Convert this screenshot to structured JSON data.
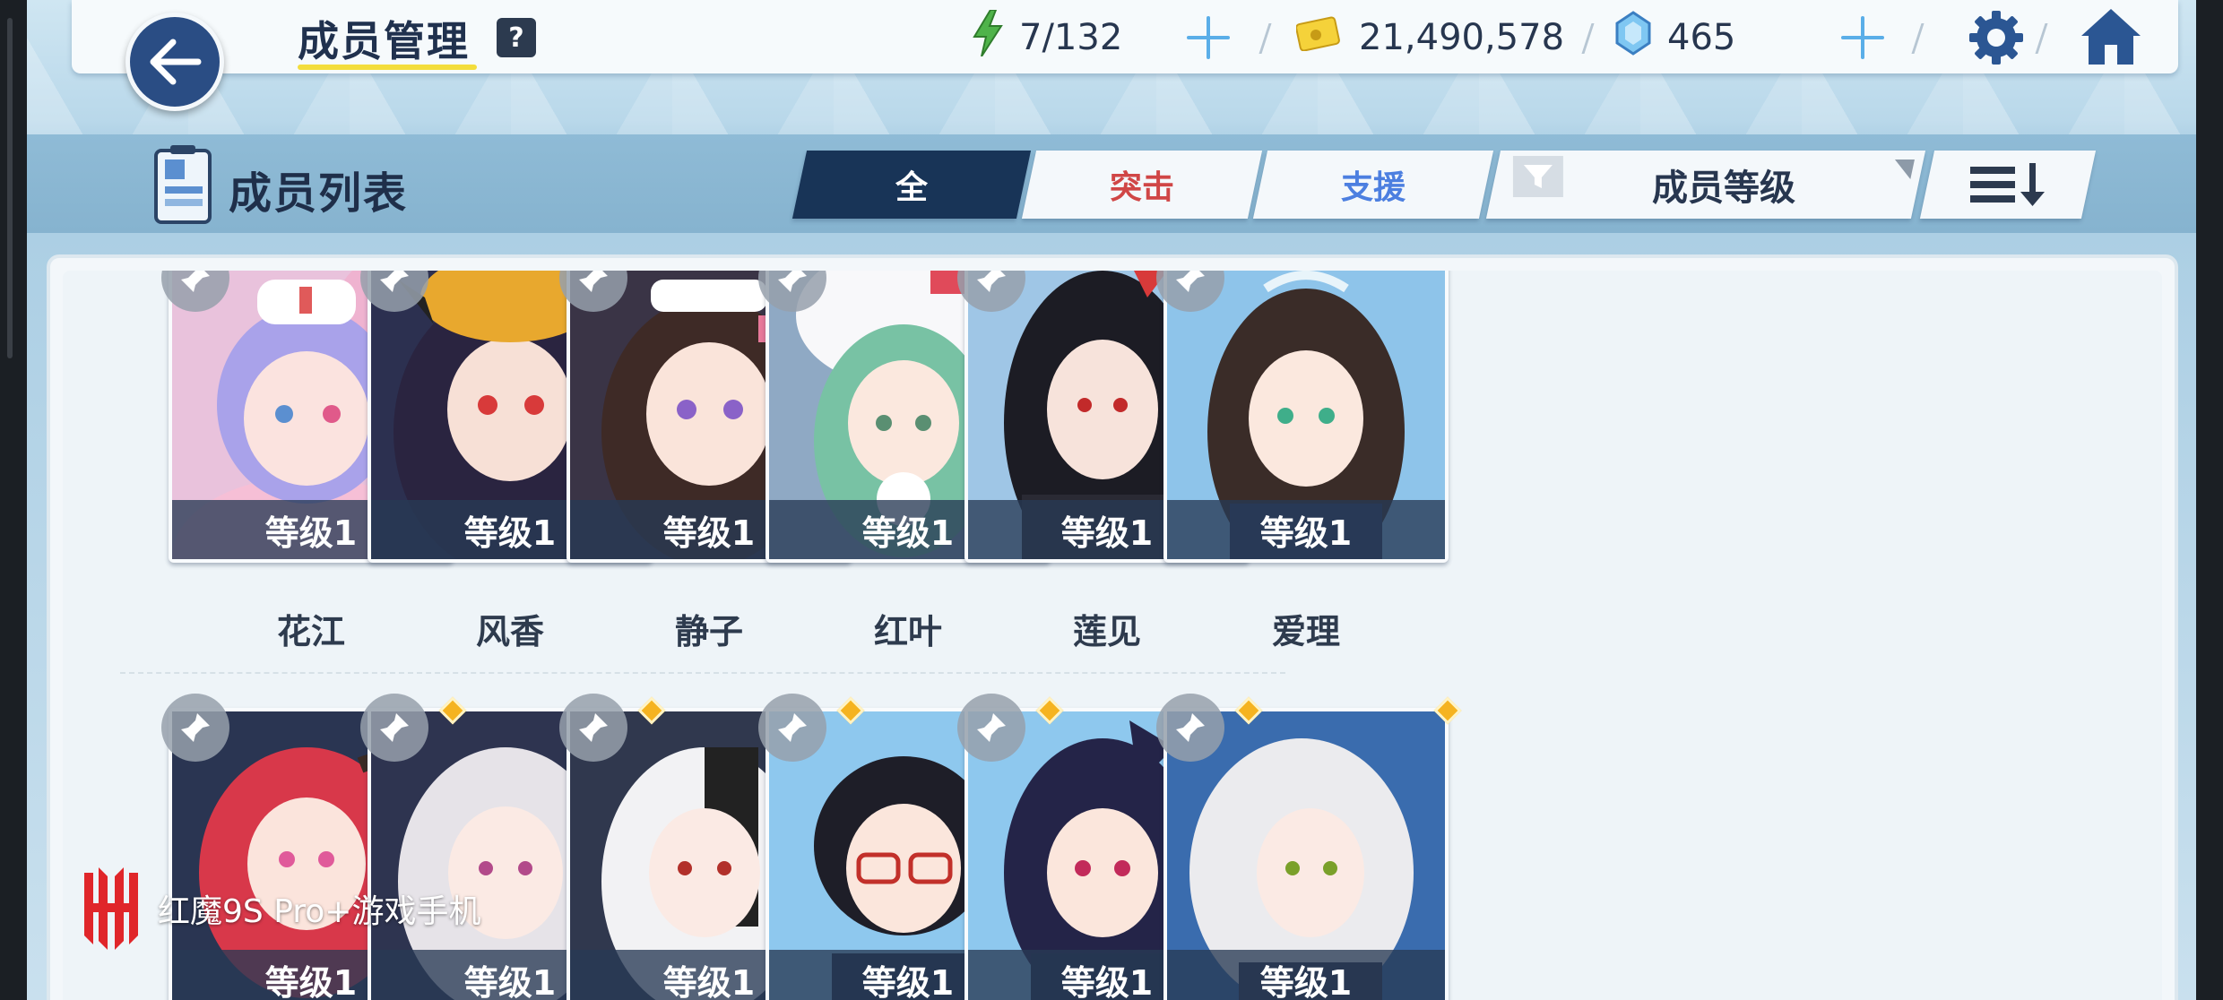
{
  "header": {
    "title": "成员管理",
    "help": "?",
    "ap": "7/132",
    "credits": "21,490,578",
    "gems": "465"
  },
  "subheader": {
    "title": "成员列表",
    "tabs": [
      {
        "label": "全",
        "active": true
      },
      {
        "label": "突击",
        "active": false
      },
      {
        "label": "支援",
        "active": false
      }
    ],
    "sort_label": "成员等级"
  },
  "members_row1": [
    {
      "name": "花江",
      "level": "等级1"
    },
    {
      "name": "风香",
      "level": "等级1"
    },
    {
      "name": "静子",
      "level": "等级1"
    },
    {
      "name": "红叶",
      "level": "等级1"
    },
    {
      "name": "莲见",
      "level": "等级1"
    },
    {
      "name": "爱理",
      "level": "等级1"
    }
  ],
  "members_row2": [
    {
      "level": "等级1"
    },
    {
      "level": "等级1"
    },
    {
      "level": "等级1"
    },
    {
      "level": "等级1"
    },
    {
      "level": "等级1"
    },
    {
      "level": "等级1"
    }
  ],
  "watermark": "红魔9S Pro+游戏手机",
  "colors": {
    "accent_dark": "#183457",
    "assault": "#d04646",
    "support": "#4c7fe0",
    "new_marker": "#f5b320"
  }
}
